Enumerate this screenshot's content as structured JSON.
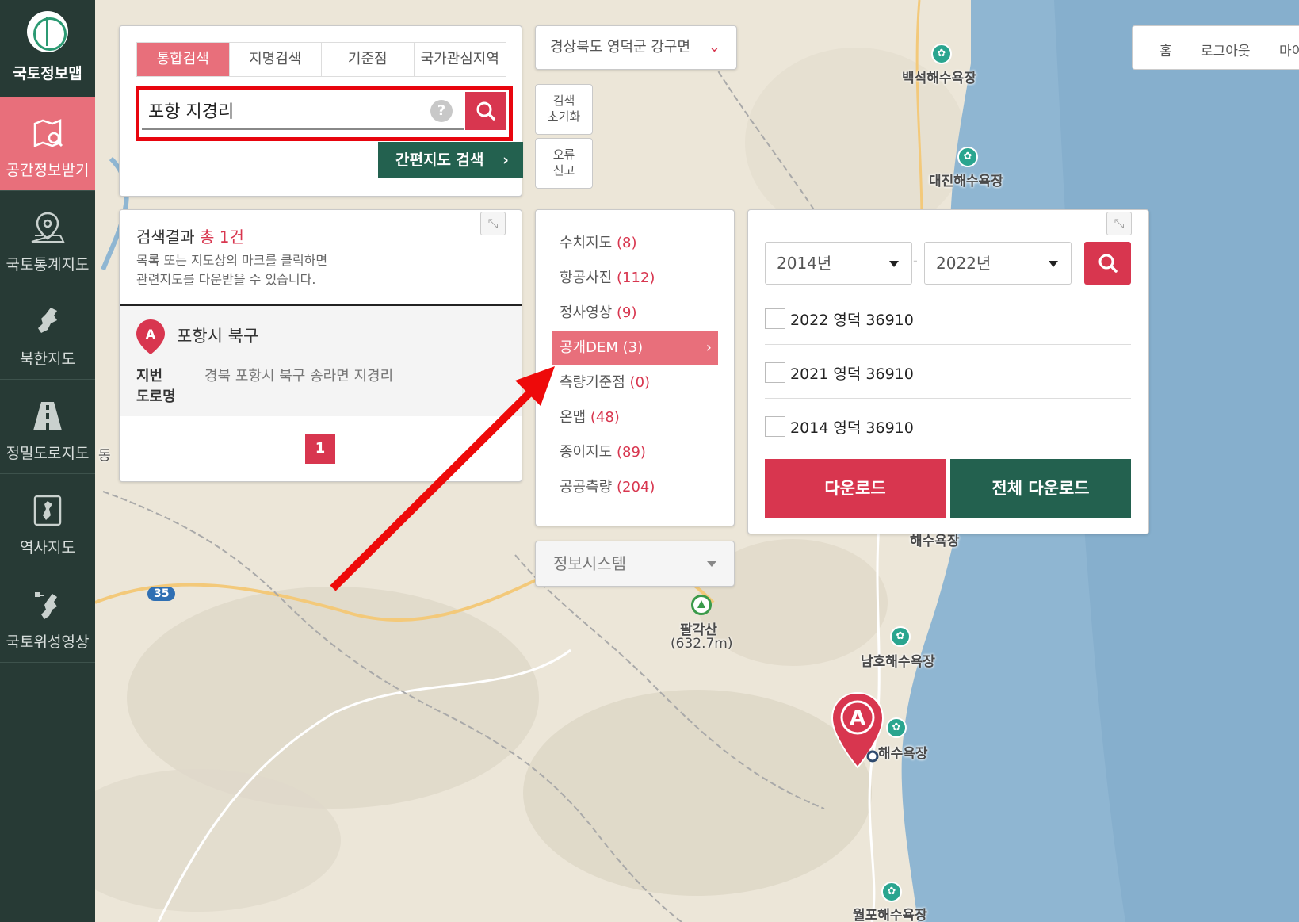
{
  "sidebar": {
    "logo_title": "국토정보맵",
    "items": [
      {
        "label": "공간정보받기",
        "icon": "map-search-icon"
      },
      {
        "label": "국토통계지도",
        "icon": "location-pin-icon"
      },
      {
        "label": "북한지도",
        "icon": "north-korea-map-icon"
      },
      {
        "label": "정밀도로지도",
        "icon": "road-icon"
      },
      {
        "label": "역사지도",
        "icon": "history-map-icon"
      },
      {
        "label": "국토위성영상",
        "icon": "satellite-image-icon"
      }
    ]
  },
  "search": {
    "tabs": [
      "통합검색",
      "지명검색",
      "기준점",
      "국가관심지역"
    ],
    "active_tab": "통합검색",
    "query": "포항 지경리",
    "help": "?",
    "quick_map_search": "간편지도 검색"
  },
  "region": {
    "selected": "경상북도 영덕군 강구면"
  },
  "actions": {
    "reset": [
      "검색",
      "초기화"
    ],
    "report": [
      "오류",
      "신고"
    ]
  },
  "results": {
    "title_prefix": "검색결과",
    "count_text": "총 1건",
    "desc_line1": "목록 또는 지도상의 마크를 클릭하면",
    "desc_line2": "관련지도를 다운받을 수 있습니다.",
    "item": {
      "marker": "A",
      "name": "포항시 북구",
      "jibun_label": "지번",
      "jibun_value": "경북 포항시 북구 송라면 지경리",
      "road_label": "도로명"
    },
    "page": "1"
  },
  "categories": [
    {
      "name": "수치지도",
      "count": "(8)"
    },
    {
      "name": "항공사진",
      "count": "(112)"
    },
    {
      "name": "정사영상",
      "count": "(9)"
    },
    {
      "name": "공개DEM",
      "count": "(3)"
    },
    {
      "name": "측량기준점",
      "count": "(0)"
    },
    {
      "name": "온맵",
      "count": "(48)"
    },
    {
      "name": "종이지도",
      "count": "(89)"
    },
    {
      "name": "공공측량",
      "count": "(204)"
    }
  ],
  "active_category": "공개DEM",
  "info_system": "정보시스템",
  "download": {
    "year_from": "2014년",
    "year_to": "2022년",
    "range_sep": "-",
    "items": [
      "2022 영덕 36910",
      "2021 영덕 36910",
      "2014 영덕 36910"
    ],
    "download_label": "다운로드",
    "download_all_label": "전체 다운로드"
  },
  "top_nav": [
    "홈",
    "로그아웃",
    "마이"
  ],
  "map": {
    "labels": {
      "baekseok": "백석해수욕장",
      "daejin": "대진해수욕장",
      "partial_beach": "해수욕장",
      "palgaksan": "팔각산",
      "palgaksan_height": "(632.7m)",
      "namho": "남호해수욕장",
      "marker_beach": "해수욕장",
      "wolpo": "월포해수욕장",
      "partial_dong": "동",
      "route": "35"
    },
    "marker": "A"
  },
  "colors": {
    "sidebar_bg": "#273a35",
    "accent_pink": "#e86f7b",
    "accent_red": "#d8364f",
    "accent_green": "#23614f",
    "highlight_red": "#e8050e",
    "sea": "#8fb6d2"
  }
}
